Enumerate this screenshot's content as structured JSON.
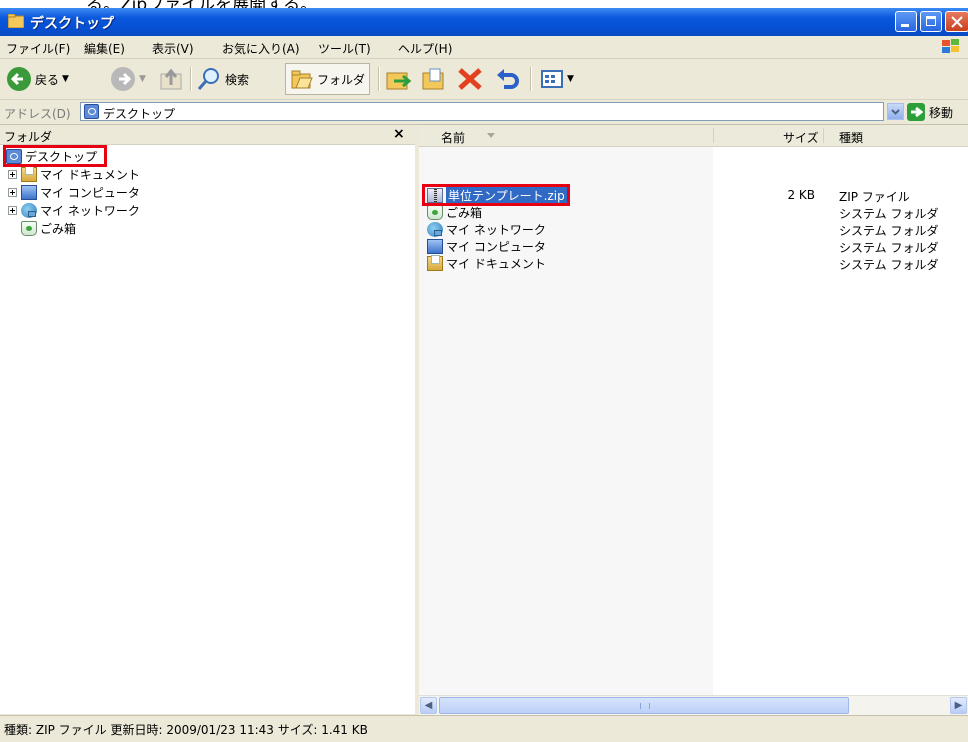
{
  "doc_heading": "る。Zipファイルを展開する。",
  "window": {
    "title": "デスクトップ"
  },
  "menu": [
    "ファイル(F)",
    "編集(E)",
    "表示(V)",
    "お気に入り(A)",
    "ツール(T)",
    "ヘルプ(H)"
  ],
  "toolbar": {
    "back": "戻る",
    "search": "検索",
    "folders": "フォルダ"
  },
  "address": {
    "label": "アドレス(D)",
    "value": "デスクトップ",
    "go": "移動"
  },
  "folder_pane": {
    "title": "フォルダ",
    "close": "×",
    "tree": [
      {
        "label": "デスクトップ",
        "icon": "desktop-icon"
      },
      {
        "label": "マイ ドキュメント",
        "icon": "my-documents-icon"
      },
      {
        "label": "マイ コンピュータ",
        "icon": "my-computer-icon"
      },
      {
        "label": "マイ ネットワーク",
        "icon": "my-network-icon"
      },
      {
        "label": "ごみ箱",
        "icon": "recycle-bin-icon"
      }
    ]
  },
  "file_list": {
    "columns": {
      "name": "名前",
      "size": "サイズ",
      "type": "種類"
    },
    "rows": [
      {
        "name": "単位テンプレート.zip",
        "size": "2 KB",
        "type": "ZIP ファイル",
        "icon": "zip-file-icon",
        "selected": true
      },
      {
        "name": "ごみ箱",
        "size": "",
        "type": "システム フォルダ",
        "icon": "recycle-bin-icon"
      },
      {
        "name": "マイ ネットワーク",
        "size": "",
        "type": "システム フォルダ",
        "icon": "my-network-icon"
      },
      {
        "name": "マイ コンピュータ",
        "size": "",
        "type": "システム フォルダ",
        "icon": "my-computer-icon"
      },
      {
        "name": "マイ ドキュメント",
        "size": "",
        "type": "システム フォルダ",
        "icon": "my-documents-icon"
      }
    ]
  },
  "status": "種類: ZIP ファイル 更新日時: 2009/01/23 11:43 サイズ: 1.41 KB",
  "colors": {
    "title_bar": "#0a58dc",
    "selection": "#316ac5",
    "highlight_box": "#e60012"
  }
}
